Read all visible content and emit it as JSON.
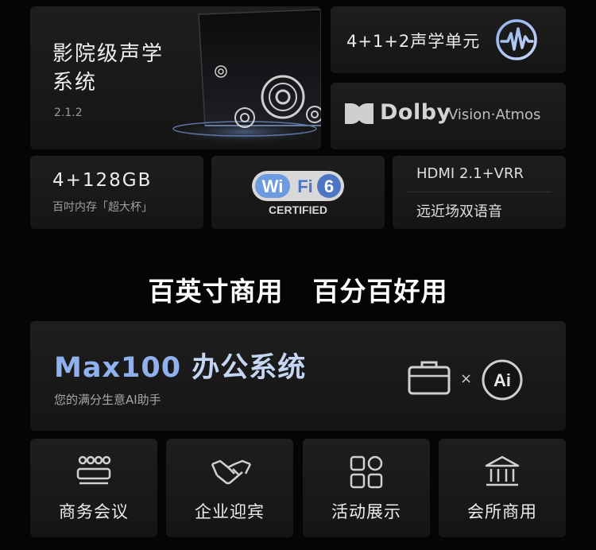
{
  "cinema": {
    "title": "影院级声学系统",
    "subtitle": "2.1.2"
  },
  "units": {
    "label": "4+1+2声学单元",
    "icon": "sound-wave-icon"
  },
  "dolby": {
    "brand": "Dolby",
    "tech": "Vision·Atmos"
  },
  "memory": {
    "size": "4+128GB",
    "desc": "百吋内存「超大杯」"
  },
  "wifi": {
    "word_wi": "Wi",
    "word_fi": "Fi",
    "version": "6",
    "certified": "CERTIFIED"
  },
  "hdmi": {
    "line1": "HDMI 2.1+VRR",
    "line2": "远近场双语音"
  },
  "headline": "百英寸商用  百分百好用",
  "office": {
    "title_en": "Max100",
    "title_cn": " 办公系统",
    "subtitle": "您的满分生意AI助手",
    "times": "×",
    "ai_badge": "Ai"
  },
  "scenes": [
    {
      "label": "商务会议",
      "icon": "meeting-icon"
    },
    {
      "label": "企业迎宾",
      "icon": "handshake-icon"
    },
    {
      "label": "活动展示",
      "icon": "apps-grid-icon"
    },
    {
      "label": "会所商用",
      "icon": "building-icon"
    }
  ],
  "colors": {
    "accent_blue": "#8fb2ee",
    "card_bg": "#1a1a1a",
    "page_bg": "#050505"
  }
}
